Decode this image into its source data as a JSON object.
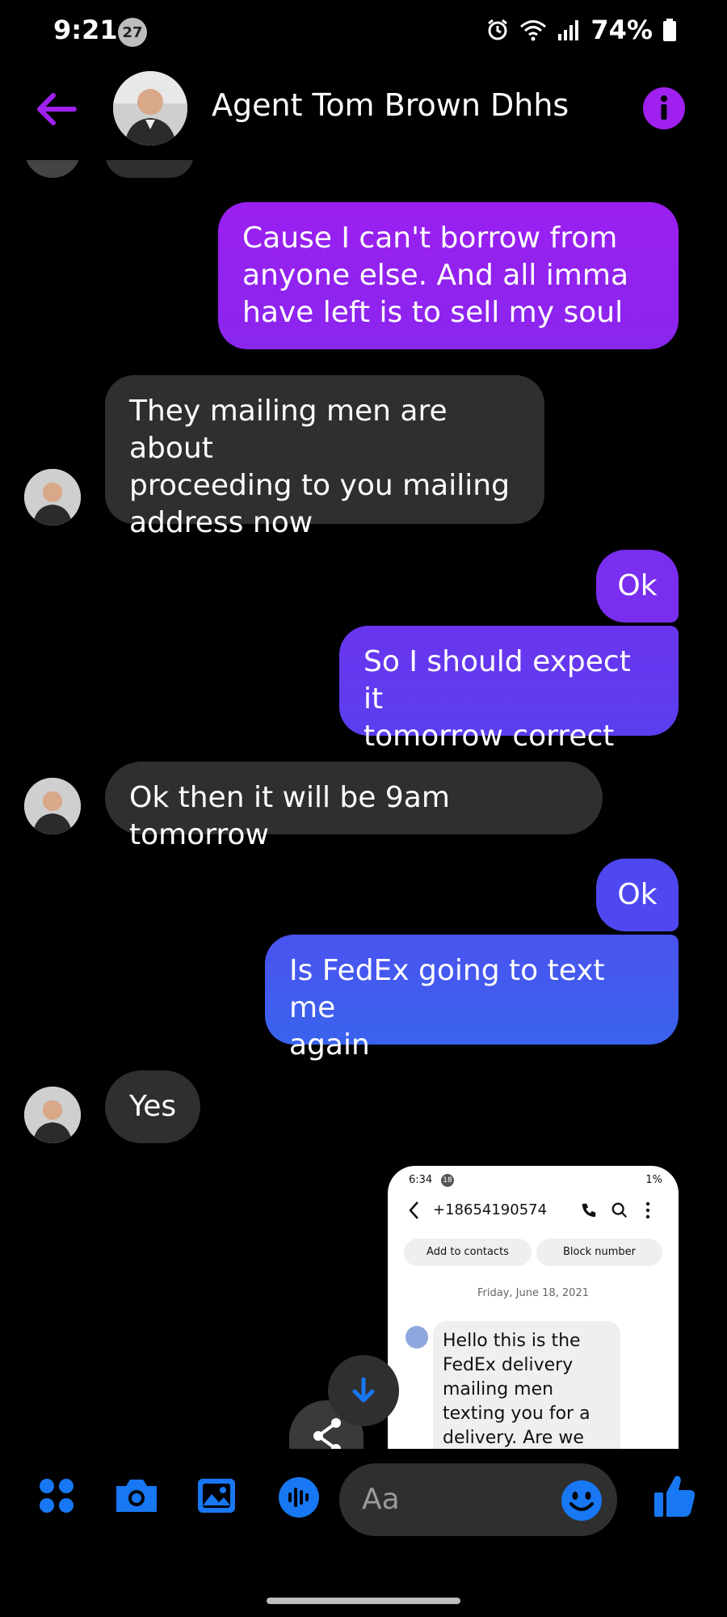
{
  "status_bar": {
    "time": "9:21",
    "notification_count": "27",
    "battery": "74%"
  },
  "header": {
    "contact_name": "Agent Tom Brown Dhhs",
    "accent_color": "#a020f0"
  },
  "messages": [
    {
      "direction": "outgoing",
      "text": "Cause I can't borrow from\nanyone else. And all imma\nhave left is to sell my soul"
    },
    {
      "direction": "incoming",
      "text": "They mailing men are about\nproceeding to you mailing\naddress now"
    },
    {
      "direction": "outgoing",
      "text": "Ok"
    },
    {
      "direction": "outgoing",
      "text": "So I should expect it\ntomorrow  correct"
    },
    {
      "direction": "incoming",
      "text": "Ok then it will be 9am tomorrow"
    },
    {
      "direction": "outgoing",
      "text": "Ok"
    },
    {
      "direction": "outgoing",
      "text": "Is FedEx going to text me\nagain"
    },
    {
      "direction": "incoming",
      "text": "Yes"
    }
  ],
  "screenshot_attachment": {
    "time": "6:34",
    "badge": "18",
    "status_right": "1%",
    "phone_number": "+18654190574",
    "add_contacts_button": "Add to contacts",
    "block_number_button": "Block number",
    "date_label": "Friday, June 18, 2021",
    "message_text": "Hello this is the\nFedEx delivery\nmailing men\ntexting you for a\ndelivery. Are we"
  },
  "composer": {
    "placeholder": "Aa",
    "icons": [
      "apps-icon",
      "camera-icon",
      "gallery-icon",
      "voice-icon",
      "emoji-icon",
      "thumbs-up-icon"
    ]
  },
  "colors": {
    "outgoing_gradient_top": "#9b1ff0",
    "outgoing_gradient_bottom": "#3a63ee",
    "incoming_bubble": "#2f2f2f",
    "icon_blue": "#1877f2"
  }
}
